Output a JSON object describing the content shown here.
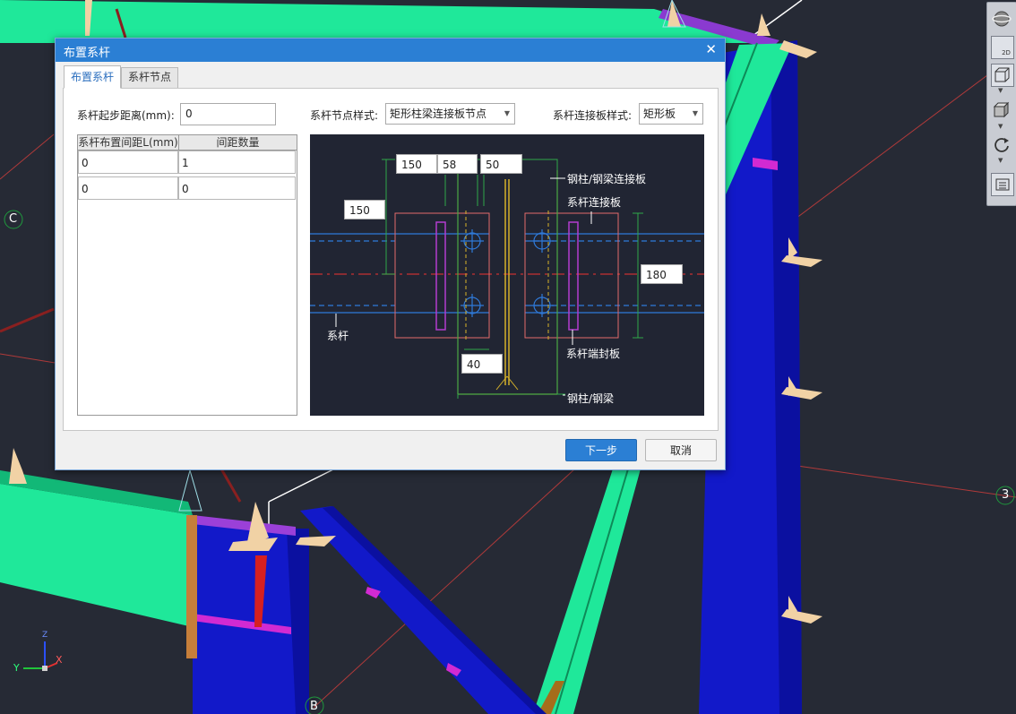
{
  "viewport": {
    "grid_labels": {
      "c": "C",
      "three": "3",
      "b": "B"
    },
    "axis": {
      "y": "Y",
      "x": "X",
      "z": "Z"
    }
  },
  "toolbar": {
    "icons": [
      "orbit-icon",
      "2d-view-icon",
      "3d-view-icon",
      "box-view-icon",
      "rotate-icon",
      "layers-icon"
    ],
    "view_2d_label": "2D"
  },
  "dialog": {
    "title": "布置系杆",
    "tabs": [
      {
        "label": "布置系杆",
        "active": true
      },
      {
        "label": "系杆节点",
        "active": false
      }
    ],
    "start_distance": {
      "label": "系杆起步距离(mm):",
      "value": "0"
    },
    "node_style": {
      "label": "系杆节点样式:",
      "value": "矩形柱梁连接板节点"
    },
    "plate_style": {
      "label": "系杆连接板样式:",
      "value": "矩形板"
    },
    "table": {
      "headers": [
        "系杆布置间距L(mm)",
        "间距数量"
      ],
      "rows": [
        [
          "0",
          "1"
        ],
        [
          "0",
          "0"
        ]
      ]
    },
    "preview": {
      "inputs": {
        "top_a": "150",
        "top_b": "58",
        "top_c": "50",
        "left": "150",
        "right": "180",
        "bottom": "40"
      },
      "labels": {
        "col_plate": "钢柱/钢梁连接板",
        "bar_plate": "系杆连接板",
        "bar": "系杆",
        "end_plate": "系杆端封板",
        "column": "钢柱/钢梁"
      }
    },
    "buttons": {
      "next": "下一步",
      "cancel": "取消"
    }
  }
}
